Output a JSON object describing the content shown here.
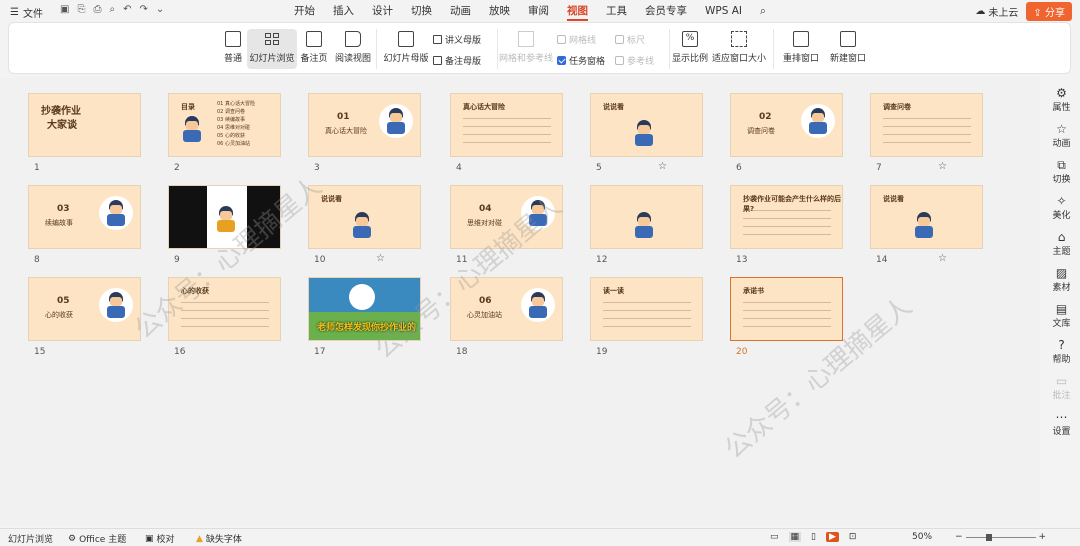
{
  "menubar": {
    "file": "文件",
    "tabs": [
      "开始",
      "插入",
      "设计",
      "切换",
      "动画",
      "放映",
      "审阅",
      "视图",
      "工具",
      "会员专享",
      "WPS AI"
    ],
    "active_tab": "视图",
    "cloud": "未上云",
    "share": "分享"
  },
  "ribbon": {
    "normal": "普通",
    "sorter": "幻灯片浏览",
    "notes": "备注页",
    "reading": "阅读视图",
    "slide_master": "幻灯片母版",
    "handout_master": "讲义母版",
    "notes_master": "备注母版",
    "grid_guides": "网格和参考线",
    "gridlines": "网格线",
    "ruler": "标尺",
    "task_pane": "任务窗格",
    "guides": "参考线",
    "zoom": "显示比例",
    "fit": "适应窗口大小",
    "arrange": "重排窗口",
    "new_window": "新建窗口"
  },
  "slides": [
    {
      "n": "1",
      "title": "抄袭作业",
      "sub": "大家谈"
    },
    {
      "n": "2",
      "title": "目录",
      "items": [
        "01 真心话大冒险",
        "02 调查问卷",
        "03 续编故事",
        "04 思维对对碰",
        "05 心的收获",
        "06 心灵加油站"
      ]
    },
    {
      "n": "3",
      "num": "01",
      "title": "真心话大冒险"
    },
    {
      "n": "4",
      "title": "真心话大冒险"
    },
    {
      "n": "5",
      "title": "说说看"
    },
    {
      "n": "6",
      "num": "02",
      "title": "调查问卷"
    },
    {
      "n": "7",
      "title": "调查问卷"
    },
    {
      "n": "8",
      "num": "03",
      "title": "续编故事"
    },
    {
      "n": "9"
    },
    {
      "n": "10",
      "title": "说说看"
    },
    {
      "n": "11",
      "num": "04",
      "title": "思维对对碰"
    },
    {
      "n": "12"
    },
    {
      "n": "13",
      "title": "抄袭作业可能会产生什么样的后果?"
    },
    {
      "n": "14",
      "title": "说说看"
    },
    {
      "n": "15",
      "num": "05",
      "title": "心的收获"
    },
    {
      "n": "16",
      "title": "心的收获"
    },
    {
      "n": "17",
      "banner": "老师怎样发现你抄作业的"
    },
    {
      "n": "18",
      "num": "06",
      "title": "心灵加油站"
    },
    {
      "n": "19",
      "title": "读一读"
    },
    {
      "n": "20",
      "title": "承诺书"
    }
  ],
  "starred": [
    "5",
    "7",
    "10",
    "14"
  ],
  "selected": "20",
  "watermark": "公众号：心理摘星人",
  "rightpanel": [
    "属性",
    "动画",
    "切换",
    "美化",
    "主题",
    "素材",
    "文库",
    "帮助",
    "批注",
    "设置"
  ],
  "status": {
    "view": "幻灯片浏览",
    "theme": "Office 主题",
    "proof": "校对",
    "missing_font": "缺失字体",
    "zoom": "50%"
  }
}
